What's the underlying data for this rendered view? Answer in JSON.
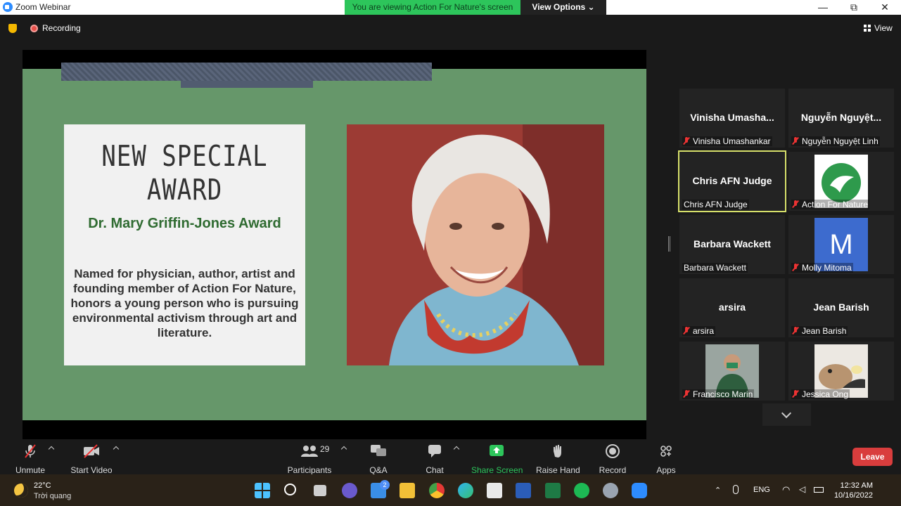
{
  "window": {
    "title": "Zoom Webinar",
    "share_banner": "You are viewing Action For Nature's screen",
    "view_options": "View Options ⌄",
    "controls": [
      "—",
      "⧉",
      "✕"
    ]
  },
  "topbar": {
    "recording_label": "Recording",
    "view_label": "View"
  },
  "slide": {
    "heading": "NEW SPECIAL AWARD",
    "award_name": "Dr. Mary Griffin-Jones Award",
    "description": "Named for physician, author, artist and founding member of Action For Nature, honors a young person who is pursuing environmental activism through art and literature."
  },
  "gallery": [
    {
      "display": "Vinisha  Umasha...",
      "label": "Vinisha Umashankar",
      "muted": true
    },
    {
      "display": "Nguyễn  Nguyệt...",
      "label": "Nguyễn Nguyệt Linh",
      "muted": true
    },
    {
      "display": "Chris AFN Judge",
      "label": "Chris AFN Judge",
      "muted": false,
      "active": true
    },
    {
      "display": "",
      "label": "Action For Nature",
      "muted": true,
      "avatar": "action-for-nature-logo"
    },
    {
      "display": "Barbara Wackett",
      "label": "Barbara Wackett",
      "muted": false
    },
    {
      "display": "",
      "label": "Molly Mitoma",
      "muted": true,
      "avatar_letter": "M"
    },
    {
      "display": "arsira",
      "label": "arsira",
      "muted": true
    },
    {
      "display": "Jean Barish",
      "label": "Jean Barish",
      "muted": true
    },
    {
      "display": "",
      "label": "Francisco Marin",
      "muted": true,
      "avatar": "photo"
    },
    {
      "display": "",
      "label": "Jessica Ong",
      "muted": true,
      "avatar": "photo"
    }
  ],
  "toolbar": {
    "unmute": "Unmute",
    "start_video": "Start Video",
    "participants": "Participants",
    "participant_count": "29",
    "qa": "Q&A",
    "chat": "Chat",
    "share_screen": "Share Screen",
    "raise_hand": "Raise Hand",
    "record": "Record",
    "apps": "Apps",
    "leave": "Leave"
  },
  "taskbar": {
    "temperature": "22°C",
    "condition": "Trời quang",
    "language": "ENG",
    "time": "12:32 AM",
    "date": "10/16/2022",
    "mail_badge": "2"
  },
  "colors": {
    "slide_green": "#66976a",
    "share_green": "#2dc55b",
    "leave_red": "#d93d3d",
    "active_outline": "#d6e06a"
  }
}
